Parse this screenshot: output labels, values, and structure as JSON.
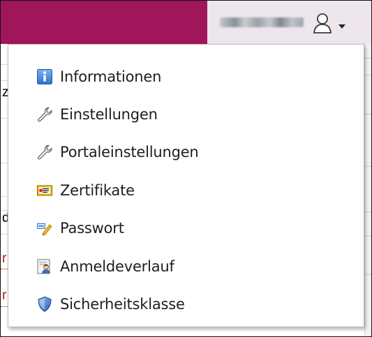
{
  "header": {
    "accent_color": "#a0165a",
    "user_area_color": "#ede6ec",
    "user_name_blurred": true,
    "user_icon": "user-icon",
    "dropdown_icon": "caret-down-icon"
  },
  "background_page": {
    "left_gutter_chars": [
      "z",
      "d",
      "r",
      "r"
    ]
  },
  "user_menu": {
    "items": [
      {
        "label": "Informationen",
        "icon": "info-icon"
      },
      {
        "label": "Einstellungen",
        "icon": "wrench-icon"
      },
      {
        "label": "Portaleinstellungen",
        "icon": "wrench-icon"
      },
      {
        "label": "Zertifikate",
        "icon": "certificate-icon"
      },
      {
        "label": "Passwort",
        "icon": "password-icon"
      },
      {
        "label": "Anmeldeverlauf",
        "icon": "login-history-icon"
      },
      {
        "label": "Sicherheitsklasse",
        "icon": "shield-icon"
      }
    ]
  }
}
